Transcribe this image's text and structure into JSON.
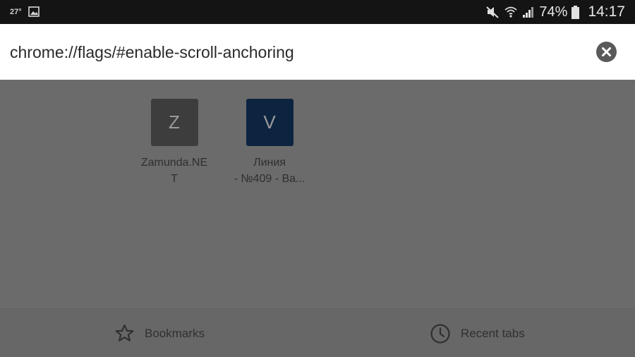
{
  "status_bar": {
    "temperature": "27°",
    "battery_percent": "74%",
    "time": "14:17"
  },
  "url_bar": {
    "value": "chrome://flags/#enable-scroll-anchoring"
  },
  "tiles": [
    {
      "letter": "Z",
      "label_line1": "Zamunda.NE",
      "label_line2": "T",
      "icon_color": "#3d3d3d"
    },
    {
      "letter": "V",
      "label_line1": "Линия",
      "label_line2": "- №409 - Ва...",
      "icon_color": "#0c2440"
    }
  ],
  "bottom_bar": {
    "bookmarks_label": "Bookmarks",
    "recent_tabs_label": "Recent tabs"
  }
}
